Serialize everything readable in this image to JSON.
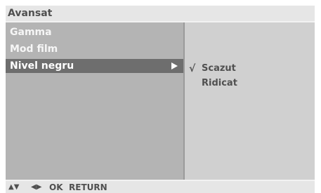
{
  "window": {
    "title": "Avansat"
  },
  "menu": {
    "items": [
      {
        "label": "Gamma"
      },
      {
        "label": "Mod film"
      },
      {
        "label": "Nivel negru",
        "selected": true
      }
    ]
  },
  "submenu": {
    "options": [
      {
        "check": "√",
        "label": "Scazut",
        "selected": true
      },
      {
        "check": "",
        "label": "Ridicat",
        "selected": false
      }
    ]
  },
  "footer": {
    "nav_updown_icon": "▲▼",
    "nav_leftright_icon": "◀▶",
    "ok_label": "OK",
    "return_label": "RETURN"
  },
  "colors": {
    "title_bar": "#e6e6e6",
    "left_pane": "#b4b4b4",
    "right_pane": "#d0d0d0",
    "highlight": "#6e6e6e",
    "text_dark": "#505050"
  }
}
